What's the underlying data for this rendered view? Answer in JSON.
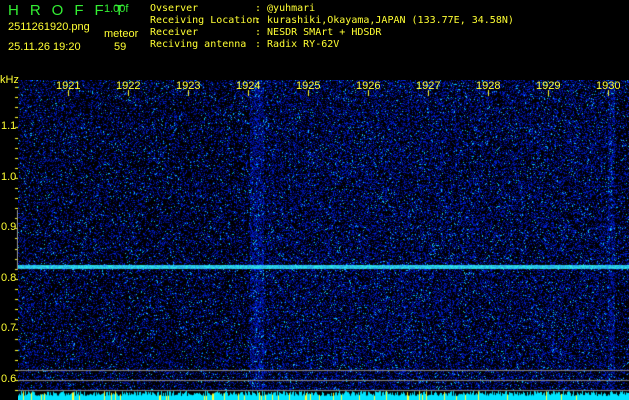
{
  "header": {
    "title": "HROFFT",
    "version": "1.00f",
    "filename": "2511261920.png",
    "datetime": "25.11.26 19:20",
    "meteor_label": "meteor",
    "meteor_count": "59"
  },
  "info": [
    {
      "key": "Ovserver",
      "value": ": @yuhmari"
    },
    {
      "key": "Receiving Location",
      "value": ": kurashiki,Okayama,JAPAN (133.77E, 34.58N)"
    },
    {
      "key": "Receiver",
      "value": ": NESDR SMArt + HDSDR"
    },
    {
      "key": "Reciving antenna",
      "value": ": Radix RY-62V"
    }
  ],
  "axis": {
    "y_unit": "kHz",
    "x_ticks": [
      "1921",
      "1922",
      "1923",
      "1924",
      "1925",
      "1926",
      "1927",
      "1928",
      "1929",
      "1930"
    ],
    "y_ticks": [
      "1.1",
      "1.0",
      "0.9",
      "0.8",
      "0.7",
      "0.6"
    ]
  },
  "colors": {
    "background": "#000000",
    "text": "#ffff33",
    "title": "#33ee33",
    "signal": "#00ffee",
    "noise": "#0a1aa0"
  }
}
